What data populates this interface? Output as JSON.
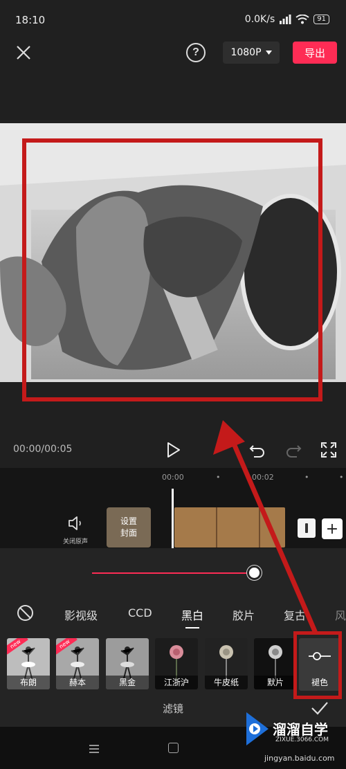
{
  "status_bar": {
    "time": "18:10",
    "network": "0.0K/s",
    "battery": "91"
  },
  "top_bar": {
    "resolution": "1080P",
    "export_label": "导出"
  },
  "playback": {
    "timecode": "00:00/00:05"
  },
  "timeline": {
    "ruler": [
      "00:00",
      "00:02"
    ],
    "mute_label": "关闭原声",
    "cover_line1": "设置",
    "cover_line2": "封面"
  },
  "filter_panel": {
    "categories": [
      "影视级",
      "CCD",
      "黑白",
      "胶片",
      "复古",
      "风"
    ],
    "active_category": "黑白",
    "filters": [
      {
        "label": "布朗",
        "new": true
      },
      {
        "label": "赫本",
        "new": true
      },
      {
        "label": "黑金",
        "new": false
      },
      {
        "label": "江浙沪",
        "new": false
      },
      {
        "label": "牛皮纸",
        "new": false
      },
      {
        "label": "默片",
        "new": false
      }
    ],
    "new_badge": "new",
    "adjust_label": "褪色",
    "title": "滤镜",
    "intensity": 1.0
  },
  "watermark": {
    "brand": "溜溜自学",
    "sub": "ZIXUE.3066.COM",
    "site": "jingyan.baidu.com"
  },
  "colors": {
    "accent": "#fe2c55",
    "annotation": "#c41a1a"
  }
}
